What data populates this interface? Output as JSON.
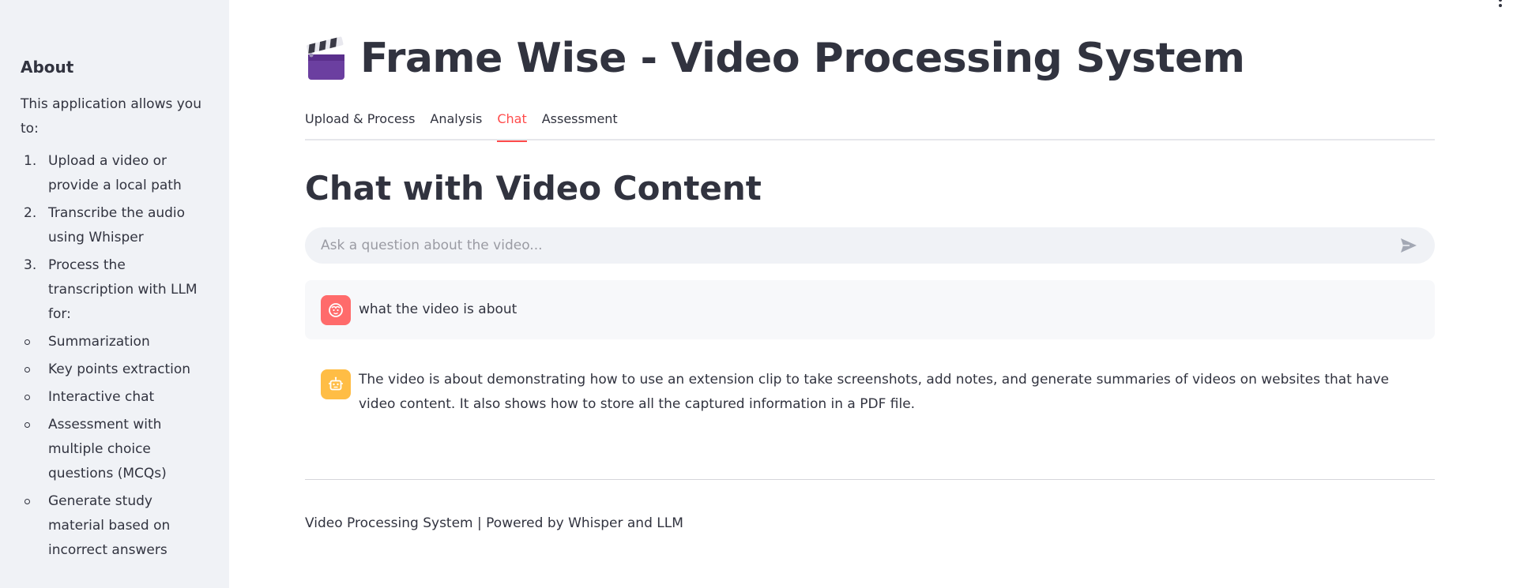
{
  "sidebar": {
    "heading": "About",
    "intro": "This application allows you to:",
    "steps": [
      {
        "num": "1.",
        "text": "Upload a video or provide a local path"
      },
      {
        "num": "2.",
        "text": "Transcribe the audio using Whisper"
      },
      {
        "num": "3.",
        "text": "Process the transcription with LLM for:"
      }
    ],
    "features": [
      "Summarization",
      "Key points extraction",
      "Interactive chat",
      "Assessment with multiple choice questions (MCQs)",
      "Generate study material based on incorrect answers"
    ]
  },
  "header": {
    "icon": "clapper-board-icon",
    "title": "Frame Wise - Video Processing System"
  },
  "tabs": [
    {
      "label": "Upload & Process",
      "active": false
    },
    {
      "label": "Analysis",
      "active": false
    },
    {
      "label": "Chat",
      "active": true
    },
    {
      "label": "Assessment",
      "active": false
    }
  ],
  "chat": {
    "title": "Chat with Video Content",
    "input_placeholder": "Ask a question about the video...",
    "input_value": "",
    "messages": [
      {
        "role": "user",
        "text": "what the video is about"
      },
      {
        "role": "assistant",
        "text": "The video is about demonstrating how to use an extension clip to take screenshots, add notes, and generate summaries of videos on websites that have video content. It also shows how to store all the captured information in a PDF file."
      }
    ]
  },
  "footer": {
    "text": "Video Processing System | Powered by Whisper and LLM"
  },
  "colors": {
    "accent": "#ff4b4b",
    "sidebar_bg": "#f0f2f6",
    "user_avatar": "#ff6b6b",
    "bot_avatar": "#ffbd45"
  }
}
